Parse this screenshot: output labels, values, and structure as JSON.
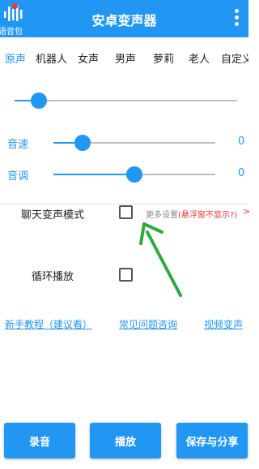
{
  "header": {
    "title": "安卓变声器",
    "logo_text": "语音包",
    "background_color": "#2196F3"
  },
  "tabs": [
    {
      "label": "原声",
      "active": true
    },
    {
      "label": "机器人",
      "active": false
    },
    {
      "label": "女声",
      "active": false
    },
    {
      "label": "男声",
      "active": false
    },
    {
      "label": "萝莉",
      "active": false
    },
    {
      "label": "老人",
      "active": false
    },
    {
      "label": "自定义",
      "active": false
    }
  ],
  "sliders": {
    "main": {
      "value_fraction": 0.11
    },
    "speed": {
      "label": "音速",
      "value": "0",
      "value_fraction": 0.18
    },
    "pitch": {
      "label": "音调",
      "value": "0",
      "value_fraction": 0.5
    }
  },
  "options": {
    "chat_mode": {
      "label": "聊天变声模式",
      "checked": false
    },
    "more_settings_gray": "更多设置",
    "more_settings_red": "(悬浮窗不显示?)",
    "more_settings_arrow": ">",
    "loop": {
      "label": "循环播放",
      "checked": false
    }
  },
  "links": {
    "tutorial": "新手教程（建议看）",
    "faq": "常见问题咨询",
    "video": "视频变声"
  },
  "buttons": {
    "record": "录音",
    "play": "播放",
    "save_share": "保存与分享"
  },
  "colors": {
    "accent": "#2196F3",
    "annotation_arrow": "#2EAA3C",
    "hint_red": "#e53935"
  }
}
